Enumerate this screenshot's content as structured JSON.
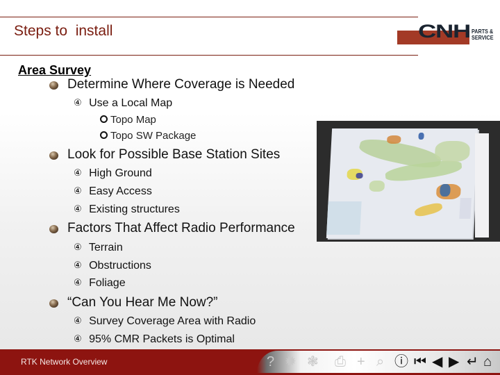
{
  "slide": {
    "title": "Steps to  install",
    "logo": {
      "brand": "CNH",
      "subtitle_line1": "PARTS &",
      "subtitle_line2": "SERVICE"
    },
    "heading": "Area Survey",
    "sections": [
      {
        "text": "Determine Where Coverage is Needed",
        "subitems": [
          {
            "text": "Use a Local Map",
            "subsubitems": [
              "Topo Map",
              "Topo SW Package"
            ]
          }
        ]
      },
      {
        "text": "Look for Possible Base Station Sites",
        "subitems": [
          {
            "text": "High Ground"
          },
          {
            "text": "Easy Access"
          },
          {
            "text": "Existing structures"
          }
        ]
      },
      {
        "text": "Factors That Affect Radio Performance",
        "subitems": [
          {
            "text": "Terrain"
          },
          {
            "text": "Obstructions"
          },
          {
            "text": "Foliage"
          }
        ]
      },
      {
        "text": "“Can You Hear Me Now?”",
        "subitems": [
          {
            "text": "Survey Coverage Area with Radio"
          },
          {
            "text": "95% CMR Packets is Optimal"
          }
        ]
      }
    ],
    "sub_marker": "④",
    "photo_alt": "Photo of a topographic map printout with colored coverage areas"
  },
  "footer": {
    "text": "RTK Network Overview",
    "nav_icons": [
      {
        "name": "help-icon",
        "glyph": "?",
        "enabled": false
      },
      {
        "name": "parts-icon",
        "glyph": "✹",
        "enabled": false
      },
      {
        "name": "video-icon",
        "glyph": "❃",
        "enabled": false
      },
      {
        "name": "print-icon",
        "glyph": "⎙",
        "enabled": false
      },
      {
        "name": "crosshair-icon",
        "glyph": "+",
        "enabled": false
      },
      {
        "name": "zoom-icon",
        "glyph": "⌕",
        "enabled": false
      },
      {
        "name": "info-icon",
        "glyph": "ⓘ",
        "enabled": true
      },
      {
        "name": "first-slide-icon",
        "glyph": "⏮",
        "enabled": true
      },
      {
        "name": "previous-slide-icon",
        "glyph": "◀",
        "enabled": true
      },
      {
        "name": "next-slide-icon",
        "glyph": "▶",
        "enabled": true
      },
      {
        "name": "return-icon",
        "glyph": "↵",
        "enabled": true
      },
      {
        "name": "home-icon",
        "glyph": "⌂",
        "enabled": true
      }
    ]
  },
  "colors": {
    "title": "#7a1d10",
    "rule": "#7a1d10",
    "footer_bg": "#8d1410",
    "logo_bar": "#a33a26",
    "logo_text": "#1a2430"
  }
}
